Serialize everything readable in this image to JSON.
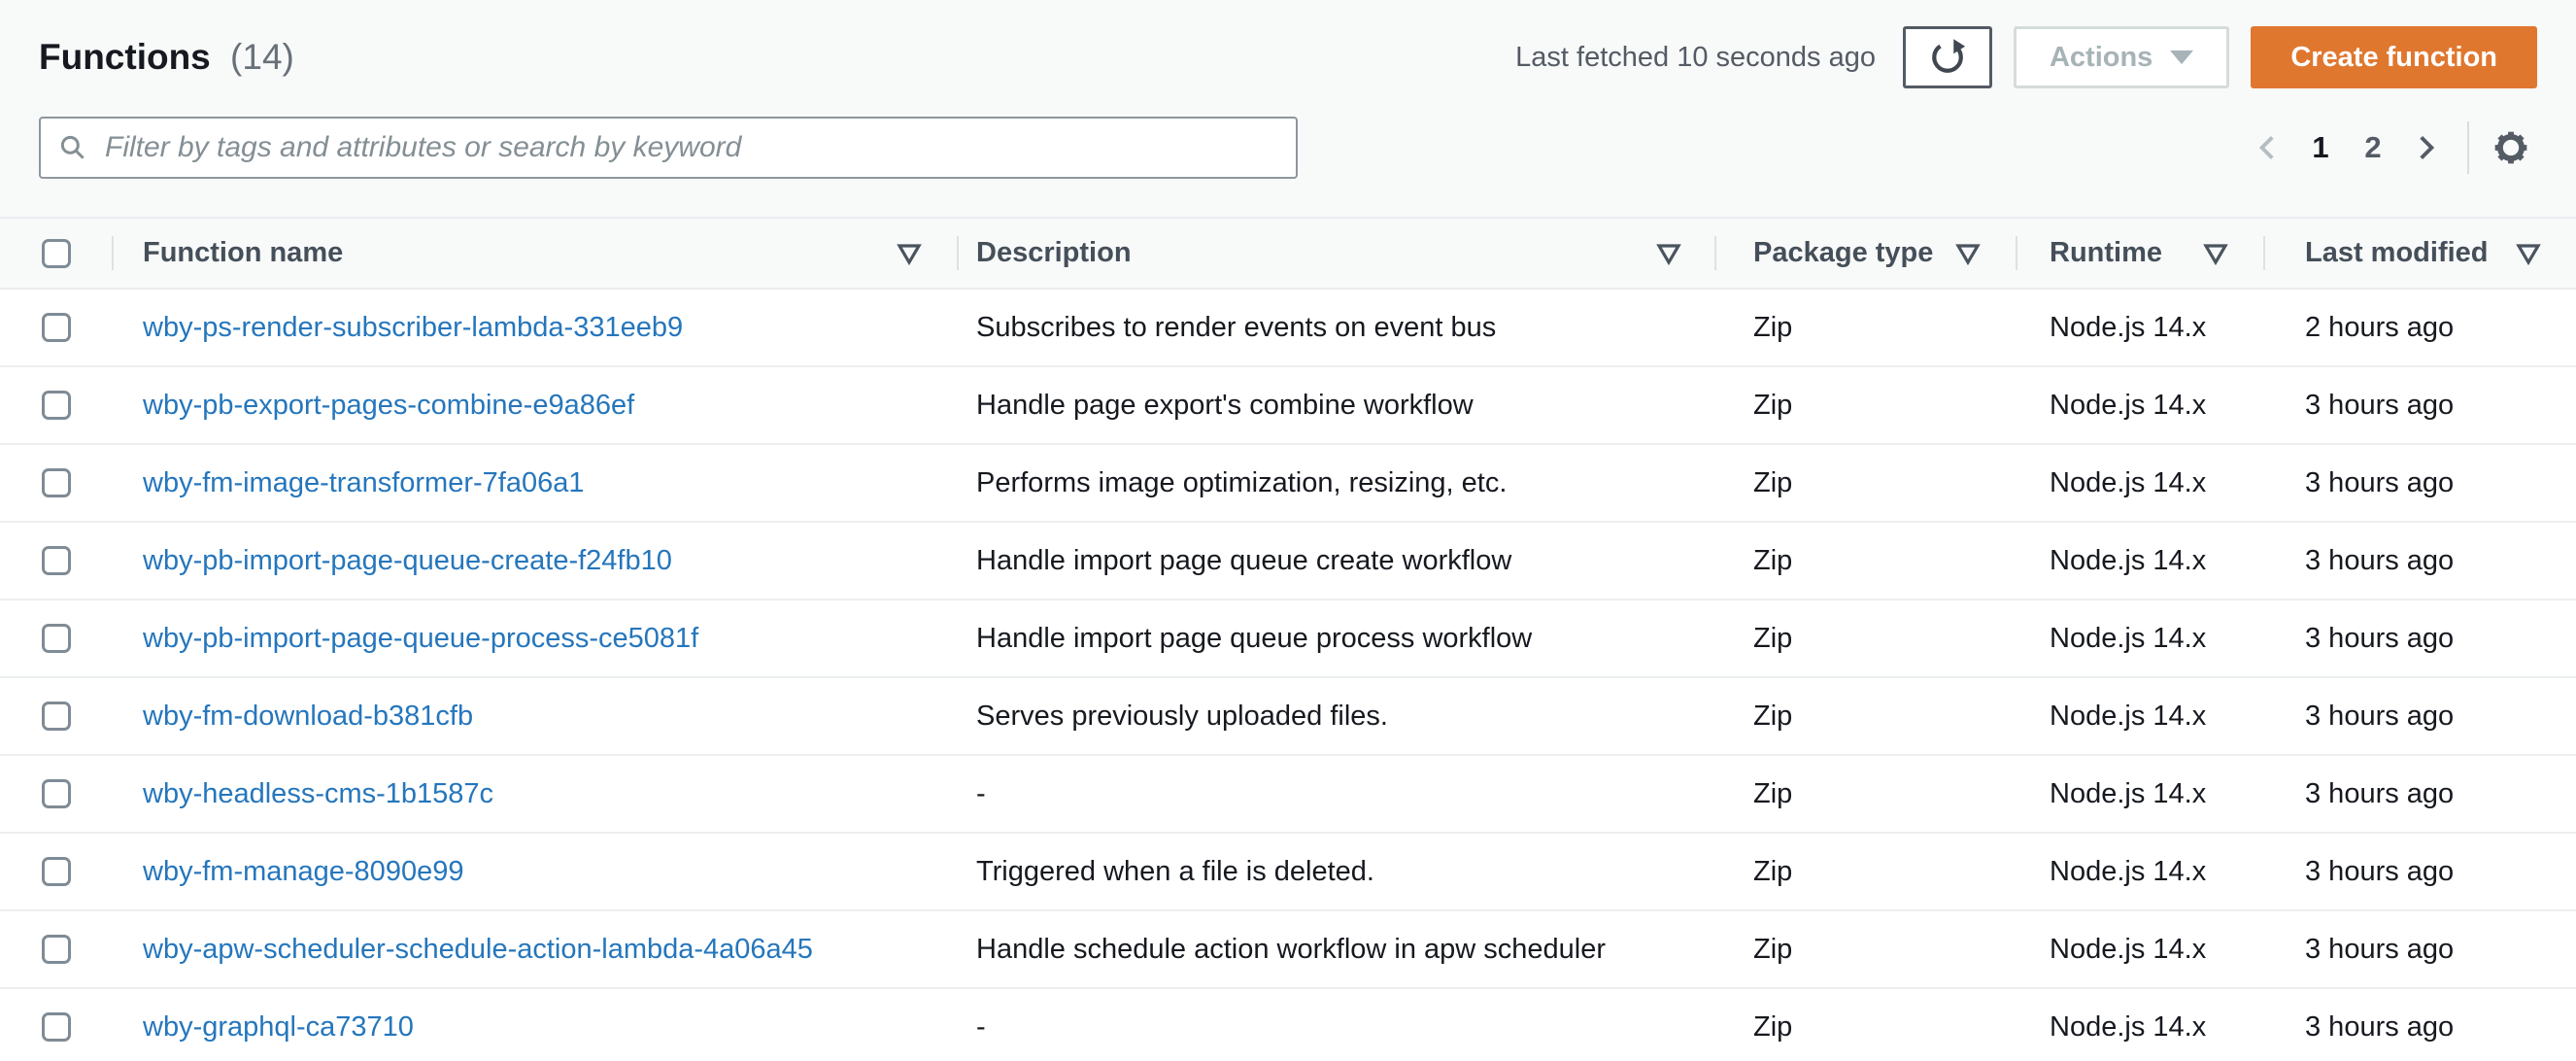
{
  "header": {
    "title": "Functions",
    "count": "(14)",
    "last_fetched": "Last fetched 10 seconds ago",
    "actions_label": "Actions",
    "create_label": "Create function"
  },
  "search": {
    "placeholder": "Filter by tags and attributes or search by keyword"
  },
  "pagination": {
    "pages": [
      "1",
      "2"
    ],
    "current_page": "1"
  },
  "icons": {
    "refresh": "refresh-icon",
    "settings": "gear-icon",
    "search": "search-icon",
    "sort": "sort-descending-outline-icon"
  },
  "colors": {
    "create_button_orange": "#e0772f",
    "link_blue": "#2576bc",
    "page_background": "#f8f9f9"
  },
  "table": {
    "columns": [
      {
        "label": "Function name",
        "sortable": true
      },
      {
        "label": "Description",
        "sortable": true
      },
      {
        "label": "Package type",
        "sortable": true
      },
      {
        "label": "Runtime",
        "sortable": true
      },
      {
        "label": "Last modified",
        "sortable": true
      }
    ],
    "rows": [
      {
        "name": "wby-ps-render-subscriber-lambda-331eeb9",
        "description": "Subscribes to render events on event bus",
        "package_type": "Zip",
        "runtime": "Node.js 14.x",
        "last_modified": "2 hours ago"
      },
      {
        "name": "wby-pb-export-pages-combine-e9a86ef",
        "description": "Handle page export's combine workflow",
        "package_type": "Zip",
        "runtime": "Node.js 14.x",
        "last_modified": "3 hours ago"
      },
      {
        "name": "wby-fm-image-transformer-7fa06a1",
        "description": "Performs image optimization, resizing, etc.",
        "package_type": "Zip",
        "runtime": "Node.js 14.x",
        "last_modified": "3 hours ago"
      },
      {
        "name": "wby-pb-import-page-queue-create-f24fb10",
        "description": "Handle import page queue create workflow",
        "package_type": "Zip",
        "runtime": "Node.js 14.x",
        "last_modified": "3 hours ago"
      },
      {
        "name": "wby-pb-import-page-queue-process-ce5081f",
        "description": "Handle import page queue process workflow",
        "package_type": "Zip",
        "runtime": "Node.js 14.x",
        "last_modified": "3 hours ago"
      },
      {
        "name": "wby-fm-download-b381cfb",
        "description": "Serves previously uploaded files.",
        "package_type": "Zip",
        "runtime": "Node.js 14.x",
        "last_modified": "3 hours ago"
      },
      {
        "name": "wby-headless-cms-1b1587c",
        "description": "-",
        "package_type": "Zip",
        "runtime": "Node.js 14.x",
        "last_modified": "3 hours ago"
      },
      {
        "name": "wby-fm-manage-8090e99",
        "description": "Triggered when a file is deleted.",
        "package_type": "Zip",
        "runtime": "Node.js 14.x",
        "last_modified": "3 hours ago"
      },
      {
        "name": "wby-apw-scheduler-schedule-action-lambda-4a06a45",
        "description": "Handle schedule action workflow in apw scheduler",
        "package_type": "Zip",
        "runtime": "Node.js 14.x",
        "last_modified": "3 hours ago"
      },
      {
        "name": "wby-graphql-ca73710",
        "description": "-",
        "package_type": "Zip",
        "runtime": "Node.js 14.x",
        "last_modified": "3 hours ago"
      }
    ]
  }
}
